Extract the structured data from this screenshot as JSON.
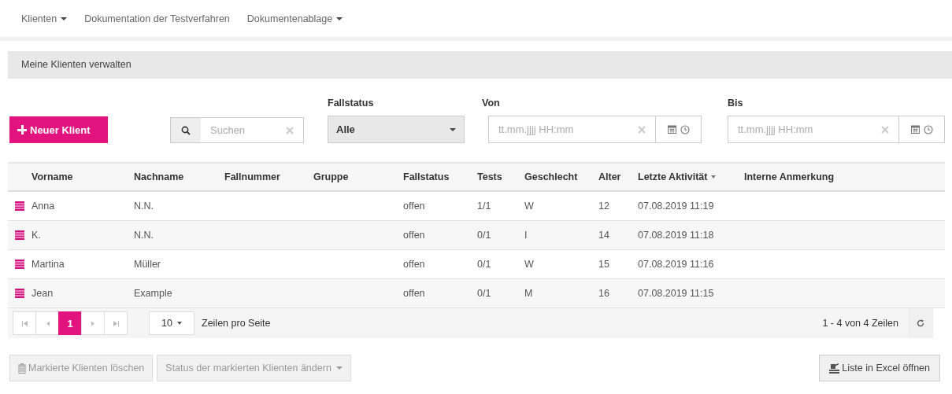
{
  "nav": [
    {
      "label": "Klienten",
      "dropdown": true
    },
    {
      "label": "Dokumentation der Testverfahren",
      "dropdown": false
    },
    {
      "label": "Dokumentenablage",
      "dropdown": true
    }
  ],
  "page_header": "Meine Klienten verwalten",
  "new_button": "Neuer Klient",
  "search": {
    "placeholder": "Suchen"
  },
  "status_filter": {
    "label": "Fallstatus",
    "value": "Alle"
  },
  "date_filters": [
    {
      "label": "Von",
      "placeholder": "tt.mm.jjjj HH:mm"
    },
    {
      "label": "Bis",
      "placeholder": "tt.mm.jjjj HH:mm"
    }
  ],
  "table": {
    "columns": [
      {
        "label": "Vorname",
        "sorted": false
      },
      {
        "label": "Nachname",
        "sorted": false
      },
      {
        "label": "Fallnummer",
        "sorted": false
      },
      {
        "label": "Gruppe",
        "sorted": false
      },
      {
        "label": "Fallstatus",
        "sorted": false
      },
      {
        "label": "Tests",
        "sorted": false
      },
      {
        "label": "Geschlecht",
        "sorted": false
      },
      {
        "label": "Alter",
        "sorted": false
      },
      {
        "label": "Letzte Aktivität",
        "sorted": true
      },
      {
        "label": "Interne Anmerkung",
        "sorted": false
      }
    ],
    "rows": [
      [
        "Anna",
        "N.N.",
        "",
        "",
        "offen",
        "1/1",
        "W",
        "12",
        "07.08.2019 11:19",
        ""
      ],
      [
        "K.",
        "N.N.",
        "",
        "",
        "offen",
        "0/1",
        "I",
        "14",
        "07.08.2019 11:18",
        ""
      ],
      [
        "Martina",
        "Müller",
        "",
        "",
        "offen",
        "0/1",
        "W",
        "15",
        "07.08.2019 11:16",
        ""
      ],
      [
        "Jean",
        "Example",
        "",
        "",
        "offen",
        "0/1",
        "M",
        "16",
        "07.08.2019 11:15",
        ""
      ]
    ]
  },
  "pager": {
    "pages": [
      {
        "label": "1",
        "selected": true
      }
    ],
    "page_size": "10",
    "page_size_label": "Zeilen pro Seite",
    "summary": "1 - 4 von 4 Zeilen"
  },
  "actions": [
    {
      "kind": "delete",
      "label": "Markierte Klienten löschen",
      "disabled": true
    },
    {
      "kind": "status",
      "label": "Status der markierten Klienten ändern",
      "disabled": true
    },
    {
      "kind": "excel",
      "label": "Liste in Excel öffnen",
      "disabled": false
    }
  ]
}
